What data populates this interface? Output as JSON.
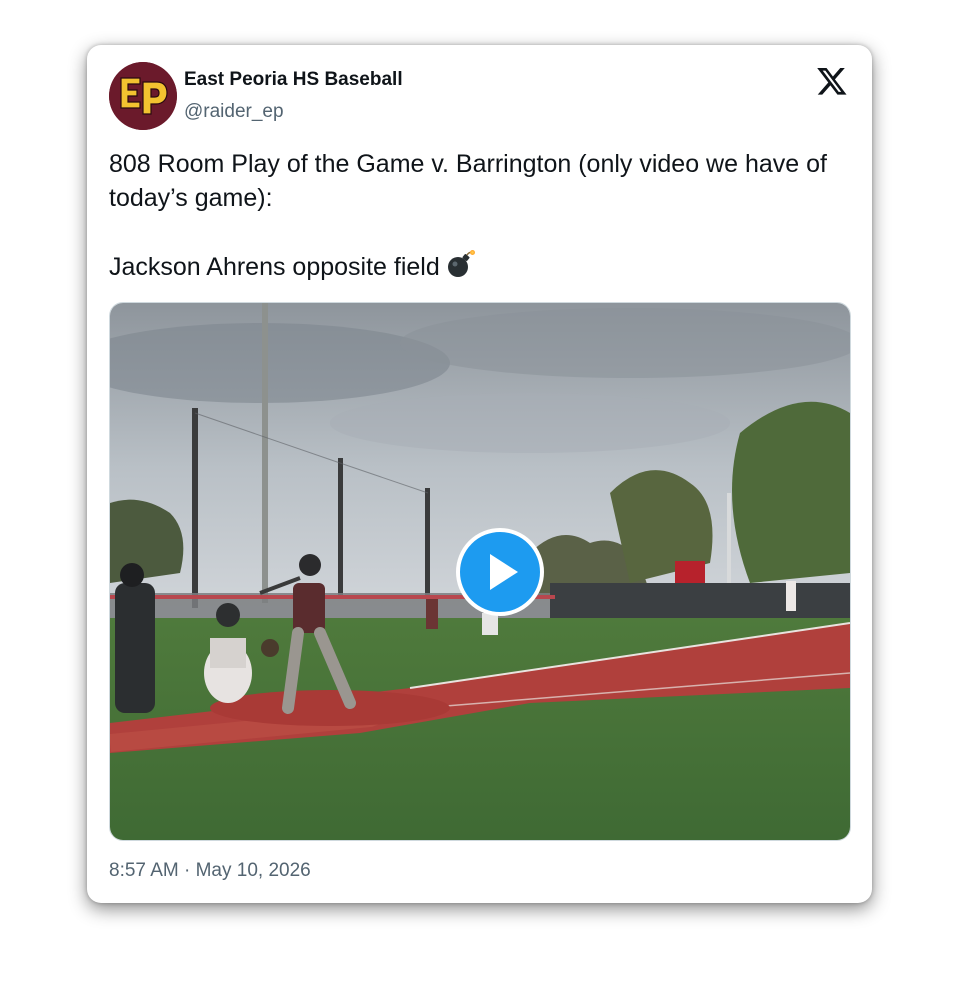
{
  "author": {
    "name": "East Peoria HS Baseball",
    "handle": "@raider_ep",
    "avatar_text": "EP"
  },
  "tweet": {
    "line1": "808 Room Play of the Game v. Barrington (only video we have of today’s game):",
    "line2": "Jackson Ahrens opposite field",
    "emoji": "bomb-icon"
  },
  "media": {
    "type": "video",
    "play_icon": "play-icon"
  },
  "meta": {
    "time": "8:57 AM",
    "separator": "·",
    "date": "May 10, 2026"
  },
  "icons": {
    "platform_logo": "x-logo-icon"
  },
  "colors": {
    "accent": "#1d9bf0",
    "text_primary": "#0f1419",
    "text_secondary": "#536471",
    "avatar_bg": "#6b1a2b",
    "avatar_letters": "#f2c230"
  }
}
